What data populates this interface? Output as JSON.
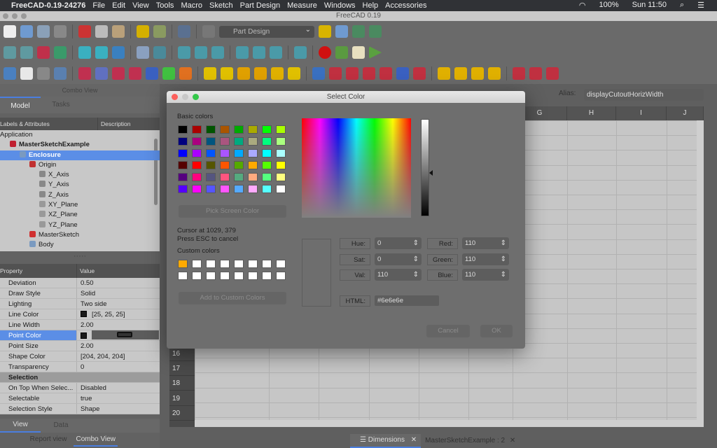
{
  "menubar": {
    "app": "FreeCAD-0.19-24276",
    "items": [
      "File",
      "Edit",
      "View",
      "Tools",
      "Macro",
      "Sketch",
      "Part Design",
      "Measure",
      "Windows",
      "Help",
      "Accessories"
    ],
    "battery": "100%",
    "clock": "Sun 11:50"
  },
  "window": {
    "title": "FreeCAD 0.19"
  },
  "toolbar": {
    "workbench": "Part Design"
  },
  "combo": {
    "title": "Combo View",
    "tabs": [
      "Model",
      "Tasks"
    ],
    "tree_headers": [
      "Labels & Attributes",
      "Description"
    ],
    "tree": [
      {
        "label": "Application",
        "depth": 0
      },
      {
        "label": "MasterSketchExample",
        "depth": 1,
        "bold": true
      },
      {
        "label": "Enclosure",
        "depth": 2,
        "selected": true
      },
      {
        "label": "Origin",
        "depth": 3
      },
      {
        "label": "X_Axis",
        "depth": 4
      },
      {
        "label": "Y_Axis",
        "depth": 4
      },
      {
        "label": "Z_Axis",
        "depth": 4
      },
      {
        "label": "XY_Plane",
        "depth": 4
      },
      {
        "label": "XZ_Plane",
        "depth": 4
      },
      {
        "label": "YZ_Plane",
        "depth": 4
      },
      {
        "label": "MasterSketch",
        "depth": 3
      },
      {
        "label": "Body",
        "depth": 3
      }
    ],
    "prop_headers": [
      "Property",
      "Value"
    ],
    "props": [
      {
        "k": "Deviation",
        "v": "0.50"
      },
      {
        "k": "Draw Style",
        "v": "Solid"
      },
      {
        "k": "Lighting",
        "v": "Two side"
      },
      {
        "k": "Line Color",
        "v": "[25, 25, 25]",
        "swatch": "#191919"
      },
      {
        "k": "Line Width",
        "v": "2.00"
      },
      {
        "k": "Point Color",
        "v": "",
        "swatch": "#191919",
        "selected": true
      },
      {
        "k": "Point Size",
        "v": "2.00"
      },
      {
        "k": "Shape Color",
        "v": "[204, 204, 204]"
      },
      {
        "k": "Transparency",
        "v": "0"
      },
      {
        "k": "Selection",
        "v": "",
        "group": true
      },
      {
        "k": "On Top When Selec...",
        "v": "Disabled"
      },
      {
        "k": "Selectable",
        "v": "true"
      },
      {
        "k": "Selection Style",
        "v": "Shape"
      }
    ],
    "bottom_tabs": [
      "View",
      "Data"
    ],
    "dock_tabs": [
      "Report view",
      "Combo View"
    ]
  },
  "sheet": {
    "alias_label": "Alias:",
    "alias_value": "displayCutoutHorizWidth",
    "columns": [
      "G",
      "H",
      "I",
      "J"
    ],
    "rows": [
      "16",
      "17",
      "18",
      "19",
      "20"
    ]
  },
  "doc_tabs": [
    "Dimensions",
    "MasterSketchExample : 2"
  ],
  "dialog": {
    "title": "Select Color",
    "basic_label": "Basic colors",
    "basic_colors": [
      "#000000",
      "#aa0000",
      "#005500",
      "#aa5500",
      "#00aa00",
      "#aaaa00",
      "#00ff00",
      "#aaff00",
      "#00007f",
      "#aa007f",
      "#00557f",
      "#aa557f",
      "#00aa7f",
      "#aaaa7f",
      "#00ff7f",
      "#aaff7f",
      "#0000ff",
      "#aa00ff",
      "#0055ff",
      "#aa55ff",
      "#00aaff",
      "#aaaaff",
      "#00ffff",
      "#aaffff",
      "#550000",
      "#ff0000",
      "#555500",
      "#ff5500",
      "#55aa00",
      "#ffaa00",
      "#55ff00",
      "#ffff00",
      "#55007f",
      "#ff007f",
      "#55557f",
      "#ff557f",
      "#55aa7f",
      "#ffaa7f",
      "#55ff7f",
      "#ffff7f",
      "#5500ff",
      "#ff00ff",
      "#5555ff",
      "#ff55ff",
      "#55aaff",
      "#ffaaff",
      "#55ffff",
      "#ffffff"
    ],
    "pick_screen": "Pick Screen Color",
    "cursor": "Cursor at 1029, 379",
    "esc": "Press ESC to cancel",
    "custom_label": "Custom colors",
    "custom_colors": [
      "#ffaa00",
      "#ffffff",
      "#ffffff",
      "#ffffff",
      "#ffffff",
      "#ffffff",
      "#ffffff",
      "#ffffff",
      "#ffffff",
      "#ffffff",
      "#ffffff",
      "#ffffff",
      "#ffffff",
      "#ffffff",
      "#ffffff",
      "#ffffff"
    ],
    "add_custom": "Add to Custom Colors",
    "hue_label": "Hue:",
    "hue": "0",
    "sat_label": "Sat:",
    "sat": "0",
    "val_label": "Val:",
    "val": "110",
    "red_label": "Red:",
    "red": "110",
    "green_label": "Green:",
    "green": "110",
    "blue_label": "Blue:",
    "blue": "110",
    "html_label": "HTML:",
    "html": "#6e6e6e",
    "cancel": "Cancel",
    "ok": "OK"
  }
}
